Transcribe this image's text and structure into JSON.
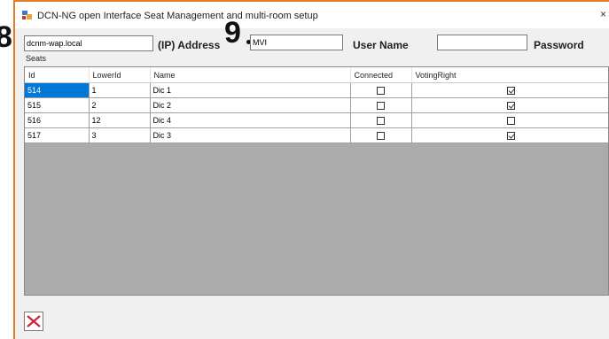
{
  "window": {
    "title": "DCN-NG open Interface Seat Management and multi-room setup",
    "close_glyph": "×"
  },
  "callouts": {
    "first": "8",
    "second": "9"
  },
  "connection": {
    "address_value": "dcnm-wap.local",
    "address_label": "(IP) Address",
    "username_value": "MVI",
    "username_label": "User Name",
    "password_value": "",
    "password_label": "Password"
  },
  "seats": {
    "label": "Seats",
    "columns": [
      "Id",
      "LowerId",
      "Name",
      "Connected",
      "VotingRight"
    ],
    "rows": [
      {
        "id": "514",
        "lower_id": "1",
        "name": "Dic 1",
        "connected": false,
        "voting_right": true,
        "selected": true
      },
      {
        "id": "515",
        "lower_id": "2",
        "name": "Dic 2",
        "connected": false,
        "voting_right": true,
        "selected": false
      },
      {
        "id": "516",
        "lower_id": "12",
        "name": "Dic 4",
        "connected": false,
        "voting_right": false,
        "selected": false
      },
      {
        "id": "517",
        "lower_id": "3",
        "name": "Dic 3",
        "connected": false,
        "voting_right": true,
        "selected": false
      }
    ]
  },
  "icons": {
    "app": "app-icon",
    "cancel": "red-x-icon"
  },
  "colors": {
    "window_border": "#e07b2b",
    "selection": "#0078d7",
    "grid_background": "#ababab",
    "cancel_x": "#d0243a"
  }
}
